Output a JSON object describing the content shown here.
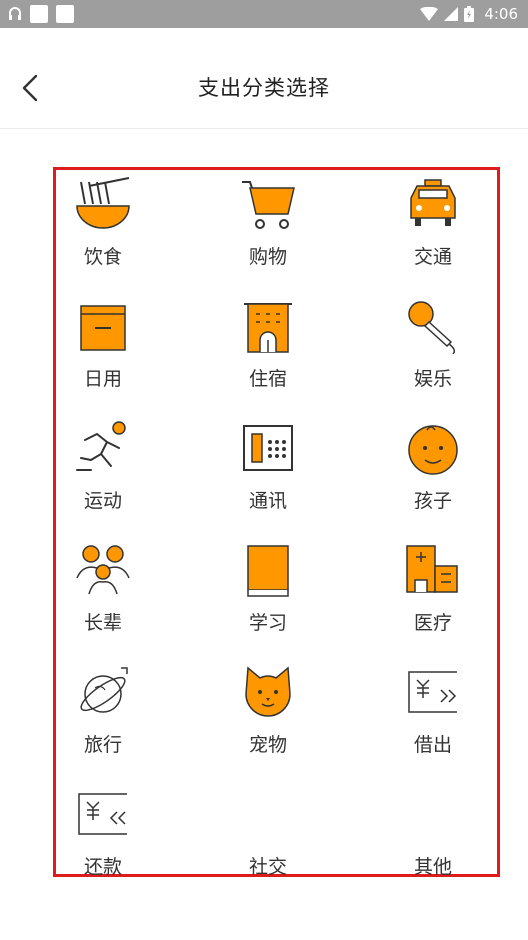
{
  "status_bar": {
    "time": "4:06"
  },
  "header": {
    "title": "支出分类选择"
  },
  "categories": [
    {
      "label": "饮食",
      "icon": "bowl-icon"
    },
    {
      "label": "购物",
      "icon": "shopping-cart-icon"
    },
    {
      "label": "交通",
      "icon": "taxi-icon"
    },
    {
      "label": "日用",
      "icon": "box-icon"
    },
    {
      "label": "住宿",
      "icon": "building-icon"
    },
    {
      "label": "娱乐",
      "icon": "microphone-icon"
    },
    {
      "label": "运动",
      "icon": "runner-icon"
    },
    {
      "label": "通讯",
      "icon": "telephone-icon"
    },
    {
      "label": "孩子",
      "icon": "baby-face-icon"
    },
    {
      "label": "长辈",
      "icon": "family-icon"
    },
    {
      "label": "学习",
      "icon": "book-icon"
    },
    {
      "label": "医疗",
      "icon": "hospital-icon"
    },
    {
      "label": "旅行",
      "icon": "planet-icon"
    },
    {
      "label": "宠物",
      "icon": "cat-icon"
    },
    {
      "label": "借出",
      "icon": "lend-icon"
    },
    {
      "label": "还款",
      "icon": "repay-icon"
    },
    {
      "label": "社交",
      "icon": "social-icon"
    },
    {
      "label": "其他",
      "icon": "other-icon"
    }
  ],
  "colors": {
    "accent": "#ff9800",
    "border": "#e01b1b",
    "status_bar": "#9e9e9e"
  }
}
